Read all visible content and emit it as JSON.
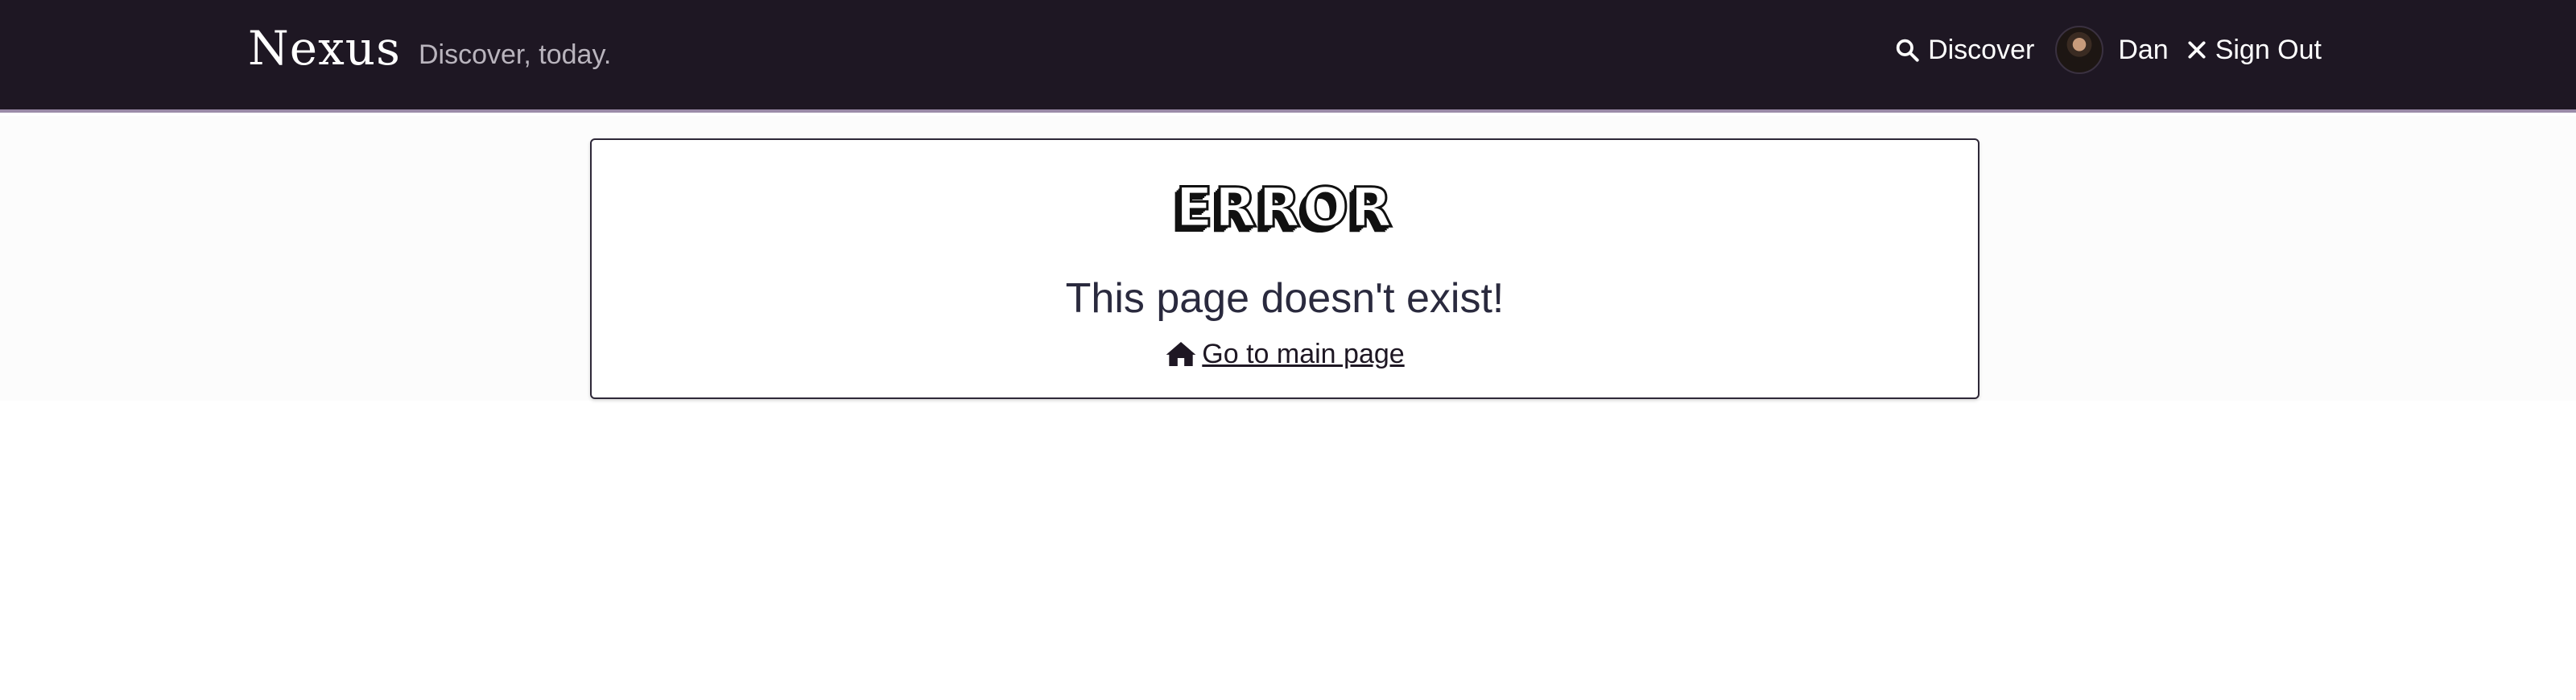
{
  "header": {
    "brand": "Nexus",
    "tagline": "Discover, today.",
    "nav": {
      "discover_label": "Discover",
      "discover_icon": "search-icon",
      "user_name": "Dan",
      "signout_label": "Sign Out",
      "signout_icon": "close-icon"
    }
  },
  "error": {
    "title": "ERROR",
    "message": "This page doesn't exist!",
    "home_link_label": " Go to main page",
    "home_icon": "home-icon"
  },
  "colors": {
    "navbar": "#1e1723",
    "navbar_border": "#9b8ba8",
    "text": "#2a2a3e"
  }
}
